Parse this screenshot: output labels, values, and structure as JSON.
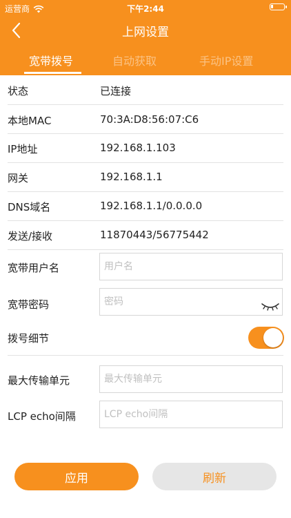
{
  "status_bar": {
    "carrier": "运营商",
    "time": "下午2:44"
  },
  "nav": {
    "title": "上网设置"
  },
  "tabs": [
    {
      "label": "宽带拨号",
      "active": true
    },
    {
      "label": "自动获取",
      "active": false
    },
    {
      "label": "手动IP设置",
      "active": false
    }
  ],
  "info": {
    "status_label": "状态",
    "status_value": "已连接",
    "mac_label": "本地MAC",
    "mac_value": "70:3A:D8:56:07:C6",
    "ip_label": "IP地址",
    "ip_value": "192.168.1.103",
    "gateway_label": "网关",
    "gateway_value": "192.168.1.1",
    "dns_label": "DNS域名",
    "dns_value": "192.168.1.1/0.0.0.0",
    "traffic_label": "发送/接收",
    "traffic_value": "11870443/56775442"
  },
  "form": {
    "username_label": "宽带用户名",
    "username_placeholder": "用户名",
    "password_label": "宽带密码",
    "password_placeholder": "密码",
    "dial_detail_label": "拨号细节",
    "dial_detail_on": true,
    "mtu_label": "最大传输单元",
    "mtu_placeholder": "最大传输单元",
    "lcp_label": "LCP echo间隔",
    "lcp_placeholder": "LCP echo间隔"
  },
  "buttons": {
    "apply": "应用",
    "refresh": "刷新"
  },
  "colors": {
    "accent": "#f7901e",
    "secondary_button": "#e6e6e6"
  },
  "icons": {
    "back": "chevron-left-icon",
    "eye": "eye-closed-icon",
    "wifi": "wifi-icon",
    "battery": "battery-icon"
  }
}
